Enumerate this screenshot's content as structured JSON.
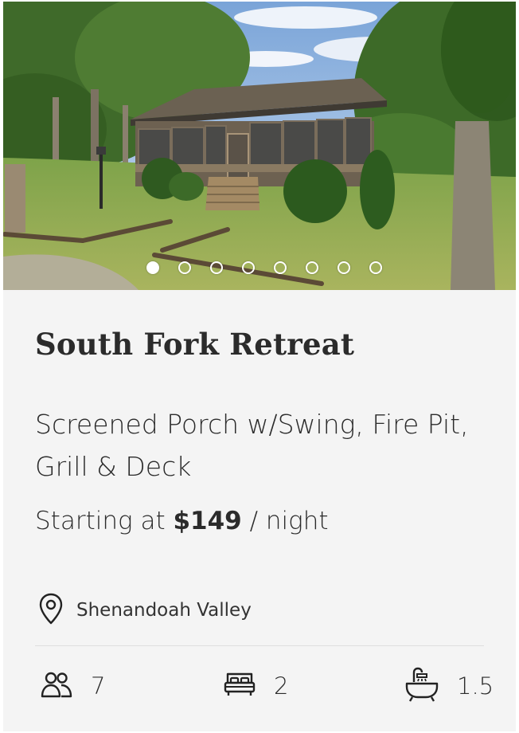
{
  "listing": {
    "title": "South Fork Retreat",
    "subtitle": "Screened Porch w/Swing, Fire Pit, Grill & Deck",
    "price": {
      "prefix": "Starting at",
      "amount": "$149",
      "suffix": "/ night"
    },
    "location": "Shenandoah Valley",
    "amenities": {
      "guests": "7",
      "bedrooms": "2",
      "bathrooms": "1.5"
    }
  },
  "carousel": {
    "slide_count": 8,
    "active_index": 0
  },
  "colors": {
    "card_background": "#f4f4f4",
    "text": "#2b2b2b",
    "dot": "#ffffff"
  },
  "icons": {
    "location": "map-pin-icon",
    "guests": "people-icon",
    "bedrooms": "bed-icon",
    "bathrooms": "bathtub-icon"
  }
}
